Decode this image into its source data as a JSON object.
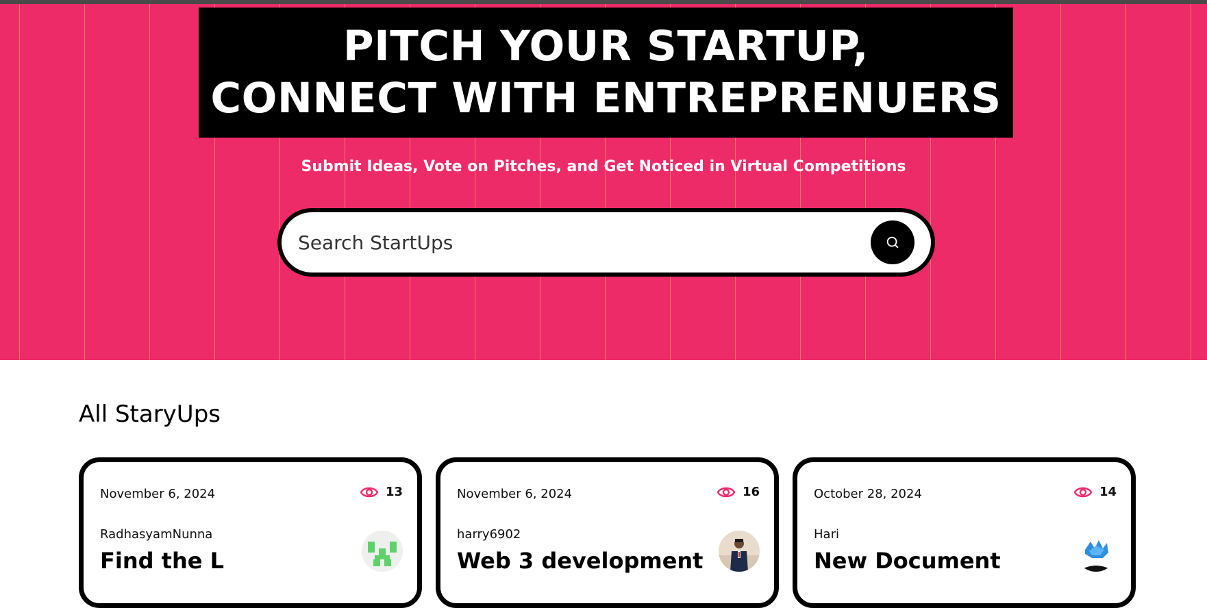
{
  "hero": {
    "title_line1": "PITCH YOUR STARTUP,",
    "title_line2": "CONNECT WITH ENTREPRENUERS",
    "subtitle": "Submit Ideas, Vote on Pitches, and Get Noticed in Virtual Competitions"
  },
  "search": {
    "placeholder": "Search StartUps",
    "button_icon": "search-icon"
  },
  "section": {
    "title": "All StaryUps"
  },
  "cards": [
    {
      "date": "November 6, 2024",
      "views": "13",
      "author": "RadhasyamNunna",
      "title": "Find the L",
      "avatar": "identicon-avatar"
    },
    {
      "date": "November 6, 2024",
      "views": "16",
      "author": "harry6902",
      "title": "Web 3 development",
      "avatar": "photo-avatar"
    },
    {
      "date": "October 28, 2024",
      "views": "14",
      "author": "Hari",
      "title": "New Document",
      "avatar": "logo-avatar"
    }
  ],
  "colors": {
    "primary": "#ee2b69",
    "stripe": "#ffb05a",
    "black": "#000000",
    "white": "#ffffff"
  }
}
